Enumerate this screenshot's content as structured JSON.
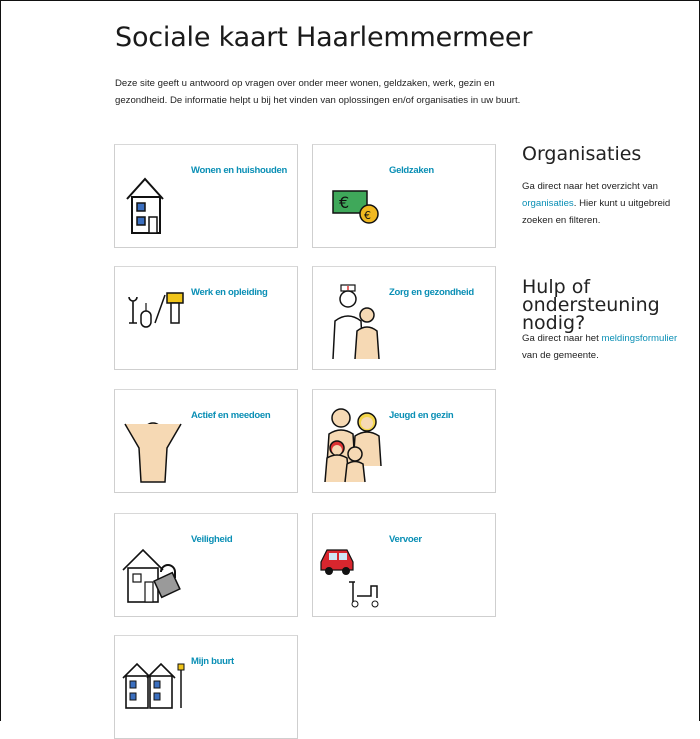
{
  "page": {
    "title": "Sociale kaart Haarlemmermeer",
    "intro": "Deze site geeft u antwoord op vragen over onder meer wonen, geldzaken, werk, gezin en gezondheid. De informatie helpt u bij het vinden van oplossingen en/of organisaties in uw buurt."
  },
  "tiles": [
    {
      "label": "Wonen en huishouden",
      "icon": "house-icon"
    },
    {
      "label": "Geldzaken",
      "icon": "money-icon"
    },
    {
      "label": "Werk en opleiding",
      "icon": "tools-icon"
    },
    {
      "label": "Zorg en gezondheid",
      "icon": "care-icon"
    },
    {
      "label": "Actief en meedoen",
      "icon": "cheering-person-icon"
    },
    {
      "label": "Jeugd en gezin",
      "icon": "family-icon"
    },
    {
      "label": "Veiligheid",
      "icon": "house-lock-icon"
    },
    {
      "label": "Vervoer",
      "icon": "car-scooter-icon"
    },
    {
      "label": "Mijn buurt",
      "icon": "neighbourhood-icon"
    }
  ],
  "sidebar": {
    "organisaties": {
      "heading": "Organisaties",
      "text_before": "Ga direct naar het overzicht van ",
      "link": "organisaties",
      "text_after": ". Hier kunt u uitgebreid zoeken en filteren."
    },
    "hulp": {
      "heading_line1": "Hulp of ondersteuning",
      "heading_line2": "nodig?",
      "text_before": "Ga direct naar het ",
      "link": "meldingsformulier",
      "text_after": "van de gemeente."
    }
  },
  "colors": {
    "link": "#0a8fb5",
    "tile_border": "#cfcfcf"
  }
}
